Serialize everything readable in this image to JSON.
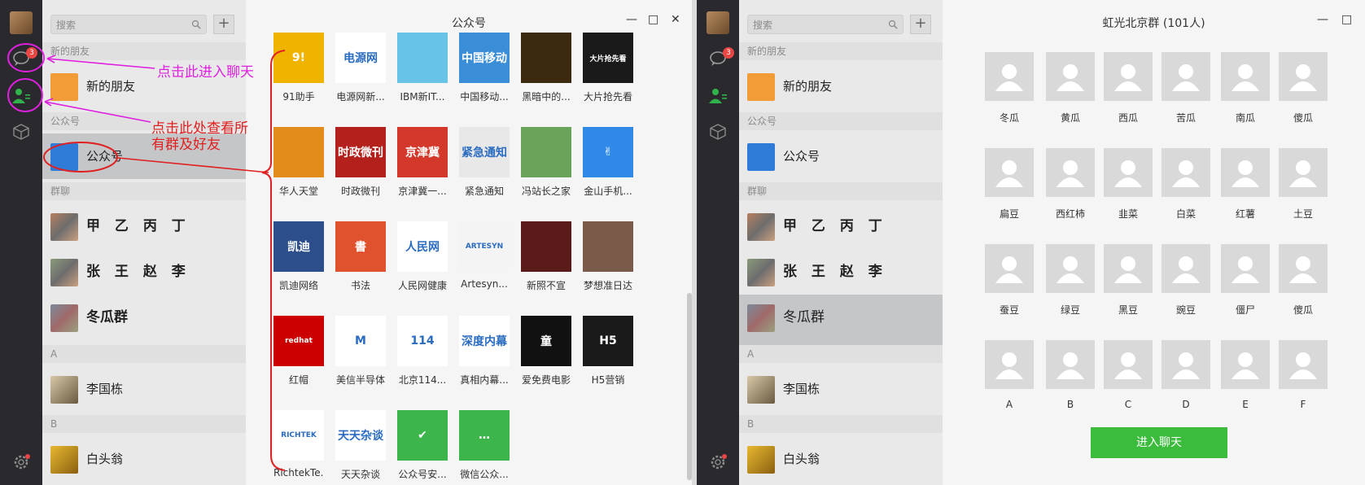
{
  "left": {
    "window_title": "公众号",
    "search_placeholder": "搜索",
    "plus": "+",
    "chat_badge": "3",
    "sections": {
      "new_friends": "新的朋友",
      "official": "公众号",
      "groups": "群聊",
      "a": "A",
      "b": "B"
    },
    "rows": {
      "new_friends": "新的朋友",
      "official": "公众号",
      "group1": "甲 乙 丙 丁",
      "group2": "张 王 赵 李",
      "group3": "冬瓜群",
      "contact_a": "李国栋",
      "contact_b": "白头翁"
    },
    "tiles": [
      {
        "label": "91助手",
        "color": "#f0b400",
        "glyph": "9!"
      },
      {
        "label": "电源网新...",
        "color": "#ffffff",
        "glyph": "电源网"
      },
      {
        "label": "IBM新IT...",
        "color": "#68c3e8",
        "glyph": ""
      },
      {
        "label": "中国移动...",
        "color": "#3a8ed8",
        "glyph": "中国移动"
      },
      {
        "label": "黑暗中的...",
        "color": "#3b2a10",
        "glyph": ""
      },
      {
        "label": "大片抢先看",
        "color": "#1a1a1a",
        "glyph": "大片抢先看"
      },
      {
        "label": "华人天堂",
        "color": "#e38c1c",
        "glyph": ""
      },
      {
        "label": "时政微刊",
        "color": "#b4201b",
        "glyph": "时政微刊"
      },
      {
        "label": "京津冀一...",
        "color": "#d4382a",
        "glyph": "京津冀"
      },
      {
        "label": "紧急通知",
        "color": "#e8e8e8",
        "glyph": "紧急通知"
      },
      {
        "label": "冯站长之家",
        "color": "#6aa35a",
        "glyph": ""
      },
      {
        "label": "金山手机...",
        "color": "#2e8ae6",
        "glyph": "✌"
      },
      {
        "label": "凯迪网络",
        "color": "#2c4f8c",
        "glyph": "凯迪"
      },
      {
        "label": "书法",
        "color": "#e0522e",
        "glyph": "書"
      },
      {
        "label": "人民网健康",
        "color": "#ffffff",
        "glyph": "人民网"
      },
      {
        "label": "Artesyn...",
        "color": "#f4f4f4",
        "glyph": "ARTESYN"
      },
      {
        "label": "新照不宣",
        "color": "#5a1a1a",
        "glyph": ""
      },
      {
        "label": "梦想准日达",
        "color": "#7a5a48",
        "glyph": ""
      },
      {
        "label": "红帽",
        "color": "#cc0000",
        "glyph": "redhat"
      },
      {
        "label": "美信半导体",
        "color": "#ffffff",
        "glyph": "M"
      },
      {
        "label": "北京114...",
        "color": "#ffffff",
        "glyph": "114"
      },
      {
        "label": "真相内幕...",
        "color": "#ffffff",
        "glyph": "深度内幕"
      },
      {
        "label": "爱免费电影",
        "color": "#111111",
        "glyph": "童"
      },
      {
        "label": "H5营销",
        "color": "#1a1a1a",
        "glyph": "H5"
      },
      {
        "label": "RichtekTe...",
        "color": "#ffffff",
        "glyph": "RICHTEK"
      },
      {
        "label": "天天杂谈",
        "color": "#ffffff",
        "glyph": "天天杂谈"
      },
      {
        "label": "公众号安...",
        "color": "#3cb54a",
        "glyph": "✔"
      },
      {
        "label": "微信公众...",
        "color": "#3cb54a",
        "glyph": "…"
      }
    ],
    "annotations": {
      "chat_hint": "点击此进入聊天",
      "view_hint_line1": "点击此处查看所",
      "view_hint_line2": "有群及好友"
    },
    "annotation_colors": {
      "magenta": "#e020e0",
      "red": "#e02020"
    }
  },
  "right": {
    "window_title": "虹光北京群 (101人)",
    "search_placeholder": "搜索",
    "plus": "+",
    "chat_badge": "3",
    "sections": {
      "new_friends": "新的朋友",
      "official": "公众号",
      "groups": "群聊",
      "a": "A",
      "b": "B"
    },
    "rows": {
      "new_friends": "新的朋友",
      "official": "公众号",
      "group1": "甲 乙 丙 丁",
      "group2": "张 王 赵 李",
      "group3": "冬瓜群",
      "contact_a": "李国栋",
      "contact_b": "白头翁"
    },
    "members": [
      "冬瓜",
      "黄瓜",
      "西瓜",
      "苦瓜",
      "南瓜",
      "傻瓜",
      "扁豆",
      "西红柿",
      "韭菜",
      "白菜",
      "红薯",
      "土豆",
      "蚕豆",
      "绿豆",
      "黑豆",
      "豌豆",
      "僵尸",
      "傻瓜",
      "A",
      "B",
      "C",
      "D",
      "E",
      "F"
    ],
    "enter_button": "进入聊天"
  }
}
